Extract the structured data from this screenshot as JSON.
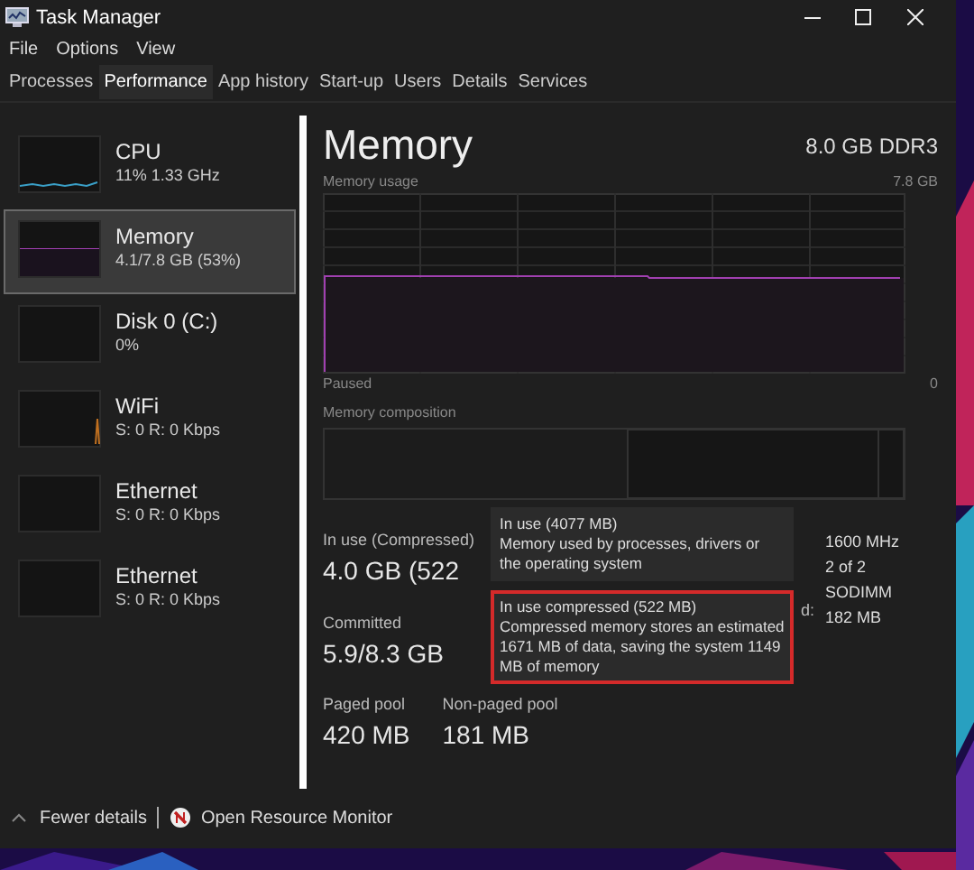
{
  "window": {
    "title": "Task Manager"
  },
  "menu": [
    "File",
    "Options",
    "View"
  ],
  "tabs": [
    {
      "label": "Processes",
      "selected": false
    },
    {
      "label": "Performance",
      "selected": true
    },
    {
      "label": "App history",
      "selected": false
    },
    {
      "label": "Start-up",
      "selected": false
    },
    {
      "label": "Users",
      "selected": false
    },
    {
      "label": "Details",
      "selected": false
    },
    {
      "label": "Services",
      "selected": false
    }
  ],
  "sidebar": {
    "items": [
      {
        "kind": "cpu",
        "name": "CPU",
        "detail": "11%  1.33 GHz",
        "selected": false
      },
      {
        "kind": "memory",
        "name": "Memory",
        "detail": "4.1/7.8 GB (53%)",
        "selected": true
      },
      {
        "kind": "disk",
        "name": "Disk 0 (C:)",
        "detail": "0%",
        "selected": false
      },
      {
        "kind": "wifi",
        "name": "WiFi",
        "detail": "S: 0 R: 0 Kbps",
        "selected": false
      },
      {
        "kind": "ethernet",
        "name": "Ethernet",
        "detail": "S: 0 R: 0 Kbps",
        "selected": false
      },
      {
        "kind": "ethernet",
        "name": "Ethernet",
        "detail": "S: 0 R: 0 Kbps",
        "selected": false
      }
    ]
  },
  "panel": {
    "title": "Memory",
    "spec": "8.0 GB DDR3",
    "usage_label": "Memory usage",
    "usage_max": "7.8 GB",
    "paused": "Paused",
    "usage_min": "0",
    "composition_label": "Memory composition",
    "stats": [
      {
        "label": "In use (Compressed)",
        "value": "4.0 GB (522"
      },
      {
        "label": "Committed",
        "value": "5.9/8.3 GB"
      },
      {
        "label": "Paged pool",
        "value": "420 MB"
      },
      {
        "label": "Non-paged pool",
        "value": "181 MB"
      }
    ],
    "hidden_label_end": "d:",
    "specs": [
      "1600 MHz",
      "2 of 2",
      "SODIMM",
      "182 MB"
    ]
  },
  "tooltip": [
    {
      "title": "In use (4077 MB)",
      "text": "Memory used by processes, drivers or the operating system",
      "highlighted": false
    },
    {
      "title": "In use compressed (522 MB)",
      "text": "Compressed memory stores an estimated 1671 MB of data, saving the system 1149 MB of memory",
      "highlighted": true
    }
  ],
  "footer": {
    "fewer": "Fewer details",
    "monitor": "Open Resource Monitor"
  }
}
